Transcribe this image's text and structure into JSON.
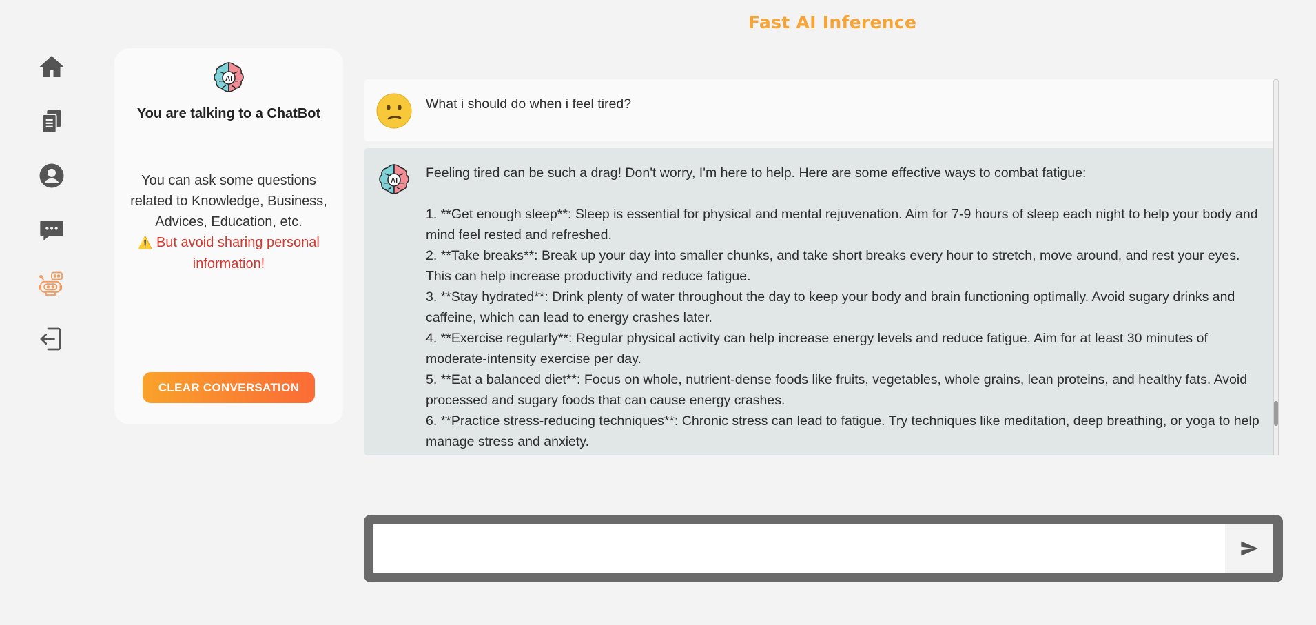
{
  "header": {
    "title": "Fast AI Inference"
  },
  "rail": {
    "items": [
      {
        "icon": "home-icon"
      },
      {
        "icon": "documents-icon"
      },
      {
        "icon": "user-icon"
      },
      {
        "icon": "chat-icon"
      },
      {
        "icon": "robot-icon",
        "active": true
      },
      {
        "icon": "logout-icon"
      }
    ],
    "colors": {
      "default": "#555555",
      "active": "#f29b5c"
    }
  },
  "info_card": {
    "title": "You are talking to a ChatBot",
    "description": "You can ask some questions related to Knowledge, Business, Advices, Education, etc.",
    "warning_icon": "⚠️",
    "warning": "But avoid sharing personal information!",
    "clear_button": "CLEAR CONVERSATION"
  },
  "chat": {
    "messages": [
      {
        "role": "user",
        "avatar": "confused-face-icon",
        "text": "What i should do when i feel tired?"
      },
      {
        "role": "bot",
        "avatar": "ai-brain-icon",
        "text": "Feeling tired can be such a drag! Don't worry, I'm here to help. Here are some effective ways to combat fatigue:\n\n1. **Get enough sleep**: Sleep is essential for physical and mental rejuvenation. Aim for 7-9 hours of sleep each night to help your body and mind feel rested and refreshed.\n2. **Take breaks**: Break up your day into smaller chunks, and take short breaks every hour to stretch, move around, and rest your eyes. This can help increase productivity and reduce fatigue.\n3. **Stay hydrated**: Drink plenty of water throughout the day to keep your body and brain functioning optimally. Avoid sugary drinks and caffeine, which can lead to energy crashes later.\n4. **Exercise regularly**: Regular physical activity can help increase energy levels and reduce fatigue. Aim for at least 30 minutes of moderate-intensity exercise per day.\n5. **Eat a balanced diet**: Focus on whole, nutrient-dense foods like fruits, vegetables, whole grains, lean proteins, and healthy fats. Avoid processed and sugary foods that can cause energy crashes.\n6. **Practice stress-reducing techniques**: Chronic stress can lead to fatigue. Try techniques like meditation, deep breathing, or yoga to help manage stress and anxiety."
      }
    ]
  },
  "composer": {
    "value": "",
    "placeholder": "",
    "send_icon": "send-icon"
  }
}
